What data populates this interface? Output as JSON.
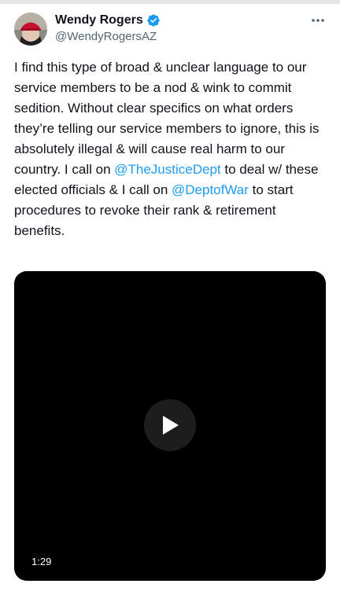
{
  "author": {
    "name": "Wendy Rogers",
    "handle": "@WendyRogersAZ",
    "verified_color": "#1d9bf0"
  },
  "tweet": {
    "segments": [
      {
        "text": "I find this type of broad & unclear language to our service members to be a nod & wink to commit sedition. Without clear specifics on what orders they’re telling our service members to ignore, this is absolutely illegal & will cause real harm to our country. I call on ",
        "type": "text"
      },
      {
        "text": "@TheJusticeDept",
        "type": "mention"
      },
      {
        "text": " to deal w/ these elected officials & I call on ",
        "type": "text"
      },
      {
        "text": "@DeptofWar",
        "type": "mention"
      },
      {
        "text": " to start procedures to revoke their rank & retirement benefits.",
        "type": "text"
      }
    ],
    "mention_color": "#1d9bf0"
  },
  "video": {
    "duration": "1:29"
  },
  "icons": {
    "more": "more-options-icon",
    "verified": "verified-badge-icon",
    "play": "play-icon"
  }
}
